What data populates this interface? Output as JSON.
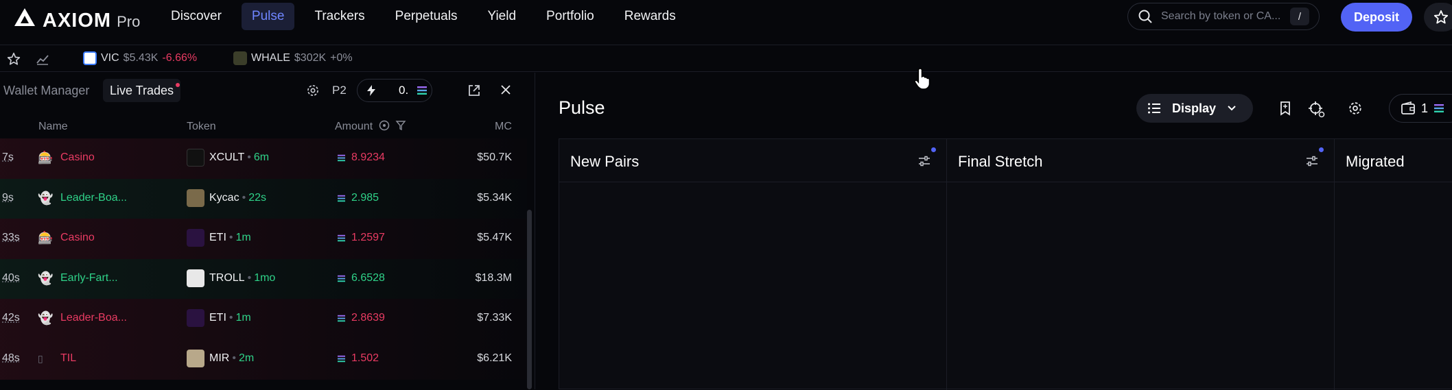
{
  "brand": {
    "name": "AXIOM",
    "suffix": "Pro"
  },
  "nav": [
    {
      "label": "Discover"
    },
    {
      "label": "Pulse",
      "active": true
    },
    {
      "label": "Trackers"
    },
    {
      "label": "Perpetuals"
    },
    {
      "label": "Yield"
    },
    {
      "label": "Portfolio"
    },
    {
      "label": "Rewards"
    }
  ],
  "search": {
    "placeholder": "Search by token or CA...",
    "shortcut": "/"
  },
  "deposit_label": "Deposit",
  "tickers": [
    {
      "symbol": "VIC",
      "mc": "$5.43K",
      "change": "-6.66%",
      "change_color": "#ea3b63"
    },
    {
      "symbol": "WHALE",
      "mc": "$302K",
      "change": "+0%",
      "change_color": "#8d909b"
    }
  ],
  "left_panel": {
    "tab_wallet_manager": "Wallet Manager",
    "tab_live_trades": "Live Trades",
    "preset": "P2",
    "quick_amount": "0.",
    "columns": {
      "name": "Name",
      "token": "Token",
      "amount": "Amount",
      "mc": "MC"
    },
    "trades": [
      {
        "age": "7s",
        "maker_icon": "🎰",
        "maker": "Casino",
        "side": "sell",
        "token": "XCULT",
        "token_age": "6m",
        "amount": "8.9234",
        "mc": "$50.7K"
      },
      {
        "age": "9s",
        "maker_icon": "👻",
        "maker": "Leader-Boa...",
        "side": "buy",
        "token": "Kycac",
        "token_age": "22s",
        "amount": "2.985",
        "mc": "$5.34K"
      },
      {
        "age": "33s",
        "maker_icon": "🎰",
        "maker": "Casino",
        "side": "sell",
        "token": "ETI",
        "token_age": "1m",
        "amount": "1.2597",
        "mc": "$5.47K"
      },
      {
        "age": "40s",
        "maker_icon": "👻",
        "maker": "Early-Fart...",
        "side": "buy",
        "token": "TROLL",
        "token_age": "1mo",
        "amount": "6.6528",
        "mc": "$18.3M"
      },
      {
        "age": "42s",
        "maker_icon": "👻",
        "maker": "Leader-Boa...",
        "side": "sell",
        "token": "ETI",
        "token_age": "1m",
        "amount": "2.8639",
        "mc": "$7.33K"
      },
      {
        "age": "48s",
        "maker_icon": "▯",
        "maker": "TIL",
        "side": "sell",
        "token": "MIR",
        "token_age": "2m",
        "amount": "1.502",
        "mc": "$6.21K"
      }
    ]
  },
  "pulse": {
    "title": "Pulse",
    "display_label": "Display",
    "wallet_count": "1",
    "columns": [
      {
        "title": "New Pairs"
      },
      {
        "title": "Final Stretch"
      },
      {
        "title": "Migrated"
      }
    ]
  },
  "colors": {
    "accent": "#5263f5",
    "buy": "#2fd389",
    "sell": "#ea3b63",
    "nav_active": "#6f86ff"
  }
}
